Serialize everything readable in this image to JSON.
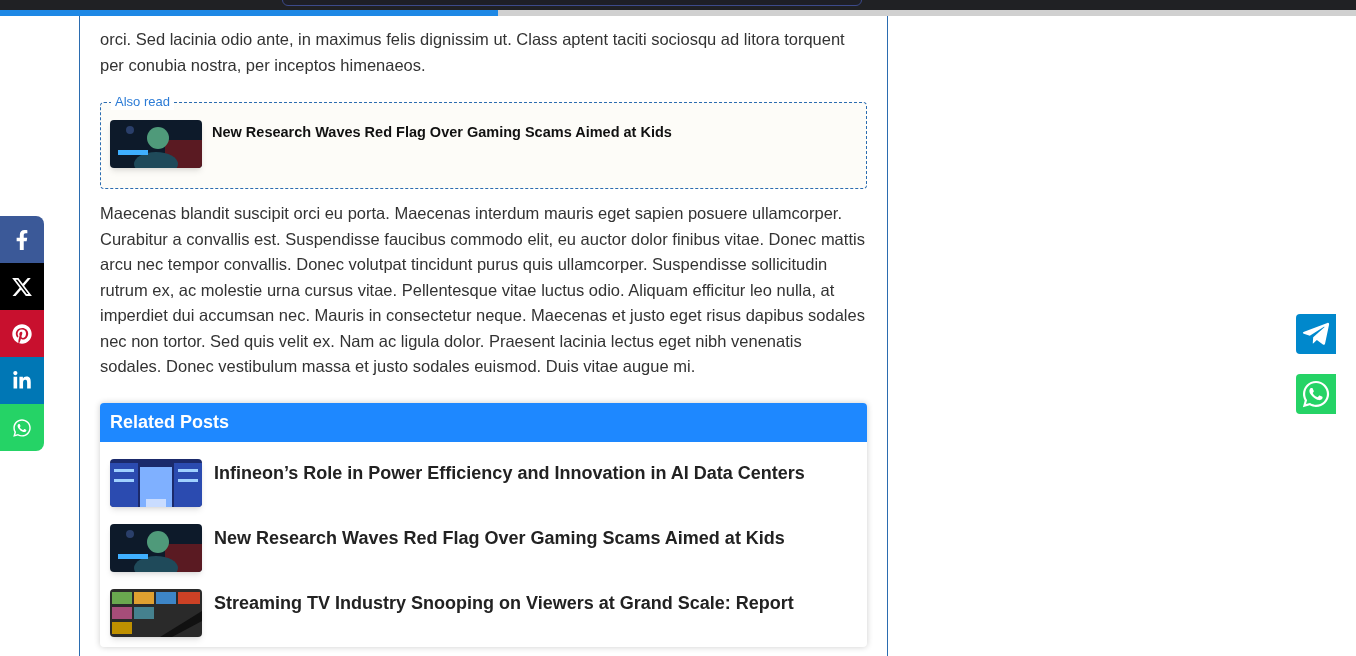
{
  "reading_progress": {
    "level": 0.367
  },
  "article": {
    "paragraphs": [
      "orci. Sed lacinia odio ante, in maximus felis dignissim ut. Class aptent taciti sociosqu ad litora torquent per conubia nostra, per inceptos himenaeos."
    ],
    "also_read": {
      "label": "Also read",
      "title": "New Research Waves Red Flag Over Gaming Scams Aimed at Kids"
    },
    "paragraphs_after": [
      "Maecenas blandit suscipit orci eu porta. Maecenas interdum mauris eget sapien posuere ullamcorper. Curabitur a convallis est. Suspendisse faucibus commodo elit, eu auctor dolor finibus vitae. Donec mattis arcu nec tempor convallis. Donec volutpat tincidunt purus quis ullamcorper. Suspendisse sollicitudin rutrum ex, ac molestie urna cursus vitae. Pellentesque vitae luctus odio. Aliquam efficitur leo nulla, at imperdiet dui accumsan nec. Mauris in consectetur neque. Maecenas et justo eget risus dapibus sodales nec non tortor. Sed quis velit ex. Nam ac ligula dolor. Praesent lacinia lectus eget nibh venenatis sodales. Donec vestibulum massa et justo sodales euismod. Duis vitae augue mi."
    ]
  },
  "related_posts": {
    "title": "Related Posts",
    "items": [
      {
        "title": "Infineon’s Role in Power Efficiency and Innovation in AI Data Centers"
      },
      {
        "title": "New Research Waves Red Flag Over Gaming Scams Aimed at Kids"
      },
      {
        "title": "Streaming TV Industry Snooping on Viewers at Grand Scale: Report"
      }
    ]
  },
  "share_bar": [
    {
      "kind": "facebook"
    },
    {
      "kind": "x"
    },
    {
      "kind": "pinterest"
    },
    {
      "kind": "linkedin"
    },
    {
      "kind": "whatsapp"
    }
  ],
  "floating_buttons": [
    {
      "kind": "telegram"
    },
    {
      "kind": "whatsapp"
    }
  ]
}
